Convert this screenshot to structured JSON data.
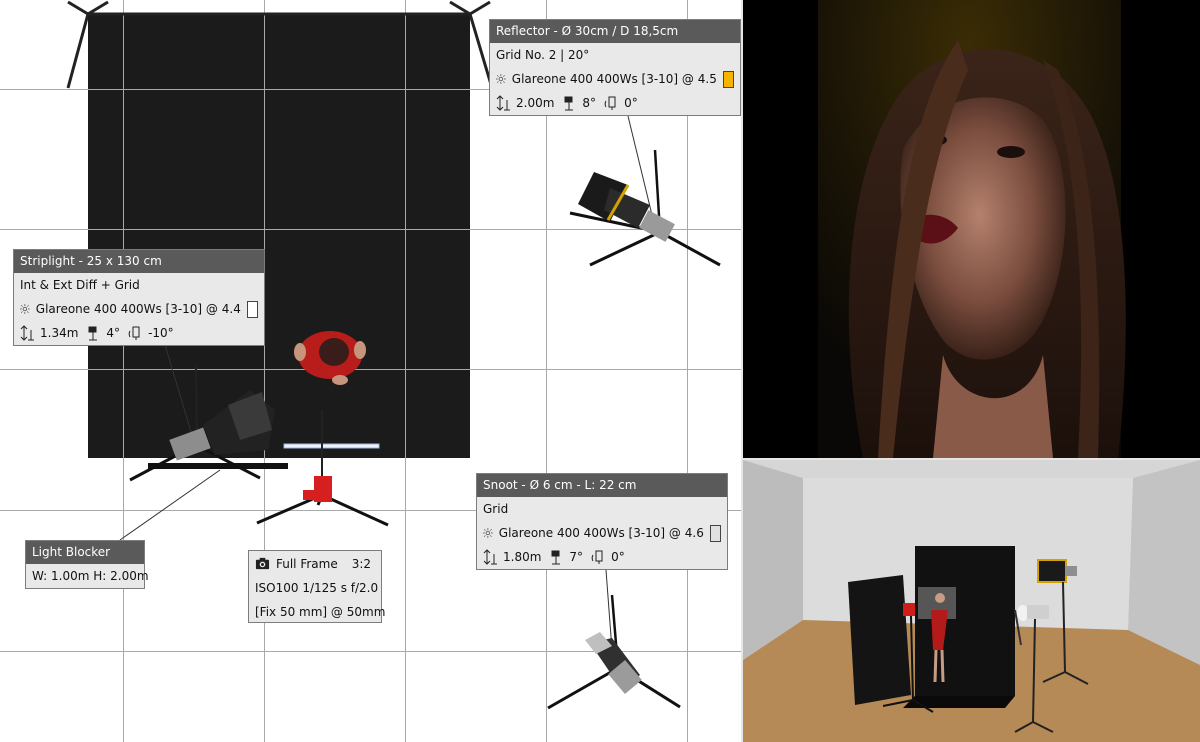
{
  "labels": {
    "reflector": {
      "title": "Reflector - Ø 30cm / D 18,5cm",
      "modifier": "Grid No. 2 | 20°",
      "light": "Glareone 400  400Ws [3-10] @ 4.5",
      "height": "2.00m",
      "tilt": "8°",
      "rotation": "0°",
      "color": "#f5b400"
    },
    "striplight": {
      "title": "Striplight - 25 x 130 cm",
      "modifier": "Int & Ext Diff + Grid",
      "light": "Glareone 400  400Ws [3-10] @ 4.4",
      "height": "1.34m",
      "tilt": "4°",
      "rotation": "-10°",
      "color": "#ffffff"
    },
    "snoot": {
      "title": "Snoot - Ø 6 cm - L: 22 cm",
      "modifier": "Grid",
      "light": "Glareone 400  400Ws [3-10] @ 4.6",
      "height": "1.80m",
      "tilt": "7°",
      "rotation": "0°",
      "color": "#e0e0e0"
    },
    "blocker": {
      "title": "Light Blocker",
      "size": "W: 1.00m  H: 2.00m"
    },
    "camera": {
      "sensor": "Full Frame",
      "ratio": "3:2",
      "exposure": "ISO100  1/125 s  f/2.0",
      "lens": "[Fix 50 mm] @ 50mm"
    }
  },
  "colors": {
    "label_header": "#5a5a5a",
    "backdrop": "#1b1b1b",
    "subject_red": "#c0201e"
  }
}
